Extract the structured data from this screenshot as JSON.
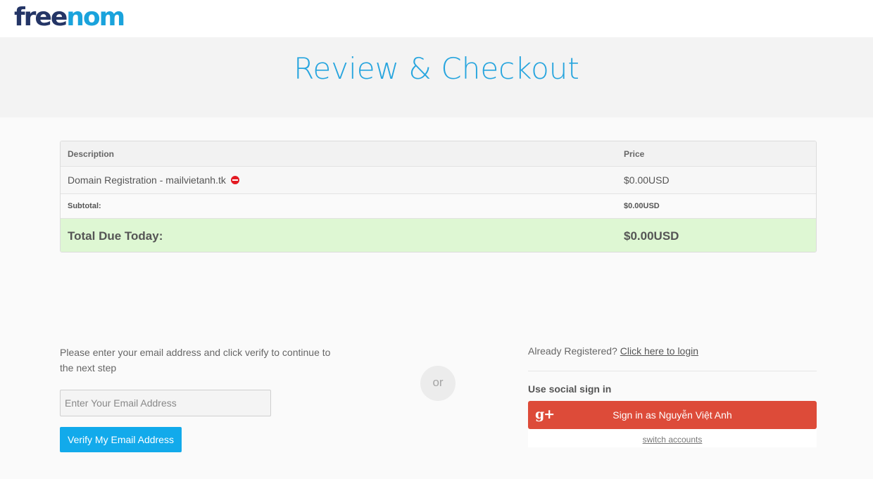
{
  "header": {
    "logo_part1": "free",
    "logo_part2": "nom"
  },
  "page_title": "Review & Checkout",
  "cart": {
    "headers": {
      "description": "Description",
      "price": "Price"
    },
    "items": [
      {
        "description": "Domain Registration - mailvietanh.tk",
        "price": "$0.00USD",
        "remove_icon": "remove-circle-icon"
      }
    ],
    "subtotal": {
      "label": "Subtotal:",
      "value": "$0.00USD"
    },
    "total": {
      "label": "Total Due Today:",
      "value": "$0.00USD"
    },
    "total_bg_color": "#def7d3"
  },
  "email_section": {
    "instruction": "Please enter your email address and click verify to continue to the next step",
    "email_placeholder": "Enter Your Email Address",
    "verify_button": "Verify My Email Address",
    "button_color": "#12aaeb"
  },
  "separator": {
    "or_label": "or"
  },
  "login_section": {
    "already_text": "Already Registered?",
    "login_link": "Click here to login",
    "social_heading": "Use social sign in",
    "google_icon_text": "g+",
    "google_button": "Sign in as Nguyễn Việt Anh",
    "google_color": "#dd4b39",
    "switch_accounts": "switch accounts"
  }
}
